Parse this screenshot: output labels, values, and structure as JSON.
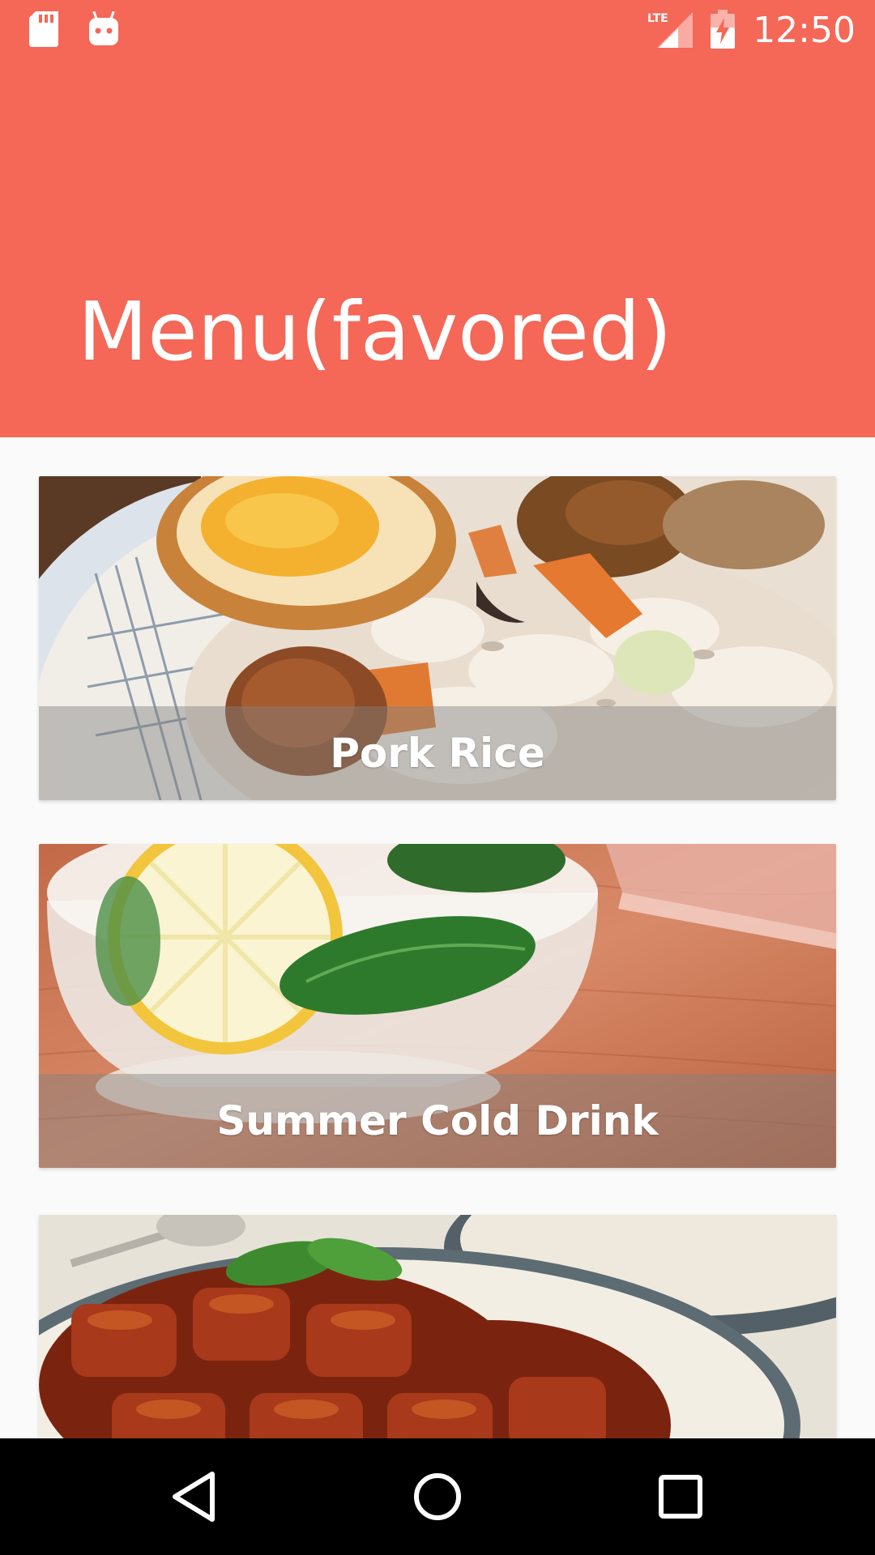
{
  "status_bar": {
    "time": "12:50",
    "network": "LTE",
    "icons": [
      "sd-card-icon",
      "android-icon",
      "lte-signal-icon",
      "battery-charging-icon"
    ]
  },
  "header": {
    "title": "Menu(favored)",
    "color": "#F56756"
  },
  "menu": {
    "items": [
      {
        "label": "Pork Rice",
        "icon": "pork-rice-photo"
      },
      {
        "label": "Summer Cold Drink",
        "icon": "cold-drink-photo"
      },
      {
        "label": "",
        "icon": "braised-pork-photo"
      }
    ]
  },
  "nav_bar": {
    "icons": [
      "back-icon",
      "home-icon",
      "recents-icon"
    ]
  }
}
